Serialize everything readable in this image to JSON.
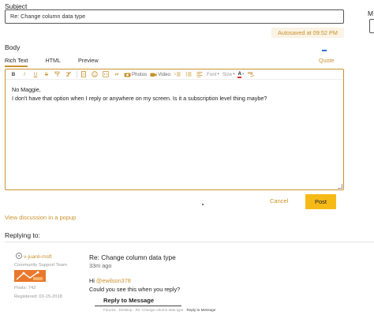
{
  "subject": {
    "label": "Subject",
    "value": "Re: Change column data type"
  },
  "side": {
    "label": "M"
  },
  "autosave": "Autosaved at 09:52 PM",
  "body": {
    "label": "Body",
    "tabs": [
      {
        "label": "Rich Text",
        "active": true
      },
      {
        "label": "HTML"
      },
      {
        "label": "Preview"
      }
    ],
    "quote": "Quote"
  },
  "toolbar": {
    "bold": "B",
    "italic": "I",
    "underline": "U",
    "strike": "S",
    "photos": "Photos",
    "video": "Video",
    "font": "Font",
    "size": "Size",
    "color": "A"
  },
  "editor": {
    "line1": "No Maggie,",
    "line2": "I don't have that option when I reply or anywhere on my screen. Is it a subscription level thing maybe?"
  },
  "actions": {
    "cancel": "Cancel",
    "post": "Post"
  },
  "popup_link": "View discussion in a popup",
  "replying": {
    "heading": "Replying to:",
    "author": {
      "name": "v-juanli-msft",
      "role": "Community Support Team",
      "posts": "Posts: 742",
      "registered": "Registered: 03-15-2018"
    },
    "message": {
      "title": "Re: Change column data type",
      "time": "33m ago",
      "greeting": "Hi ",
      "mention": "@ewilson378",
      "question": "Could you see this when you reply?",
      "reply_heading": "Reply to Message",
      "breadcrumb": [
        "Forums",
        "Desktop",
        "Re: Change column data type"
      ],
      "breadcrumb_current": "Reply to Message"
    }
  },
  "colors": {
    "accent": "#c9922e",
    "post_button": "#f5ba18",
    "autosave_bg": "#fbf3e3"
  }
}
